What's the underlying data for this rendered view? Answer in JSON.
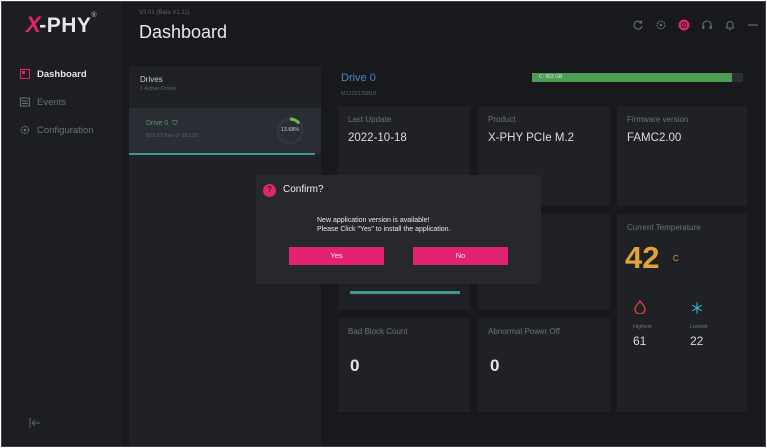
{
  "app": {
    "logo": "PHY",
    "version": "V3.01 (Beta V1.11)",
    "title": "Dashboard"
  },
  "sidebar": {
    "items": [
      {
        "label": "Dashboard",
        "icon": "dashboard-icon",
        "active": true
      },
      {
        "label": "Events",
        "icon": "events-icon",
        "active": false
      },
      {
        "label": "Configuration",
        "icon": "gear-icon",
        "active": false
      }
    ]
  },
  "header_icons": [
    "refresh-icon",
    "settings-icon",
    "record-icon",
    "headset-icon",
    "bell-icon",
    "minimize-icon"
  ],
  "drives": {
    "title": "Drives",
    "subtitle": "1 Active Drives",
    "list": [
      {
        "name": "Drive 0",
        "free": "823.03 free of 953.50",
        "percent": "13.68%",
        "used_fraction": 0.1368
      }
    ]
  },
  "drive": {
    "name": "Drive 0",
    "serial": "M1222120819",
    "capacity_label": "C: 953 GB",
    "capacity_fraction": 0.95
  },
  "cards": {
    "last_update": {
      "label": "Last Update",
      "value": "2022-10-18"
    },
    "product": {
      "label": "Product",
      "value": "X-PHY PCIe M.2"
    },
    "firmware": {
      "label": "Firmware version",
      "value": "FAMC2.00"
    },
    "temperature": {
      "label": "Current Temperature",
      "value": "42",
      "unit": "C",
      "highest_label": "Highest",
      "highest_value": "61",
      "lowest_label": "Lowest",
      "lowest_value": "22"
    },
    "bad_block": {
      "label": "Bad Block Count",
      "value": "0"
    },
    "abnormal_power": {
      "label": "Abnormal Power Off",
      "value": "0"
    }
  },
  "dialog": {
    "title": "Confirm?",
    "message_line1": "New application version is available!",
    "message_line2": "Please Click \"Yes\" to install the application.",
    "yes_label": "Yes",
    "no_label": "No"
  },
  "colors": {
    "accent": "#e2236f",
    "drive_name": "#4b86c5",
    "capacity": "#4f9d54",
    "temperature": "#e2a437",
    "teal": "#3e9a8a"
  }
}
